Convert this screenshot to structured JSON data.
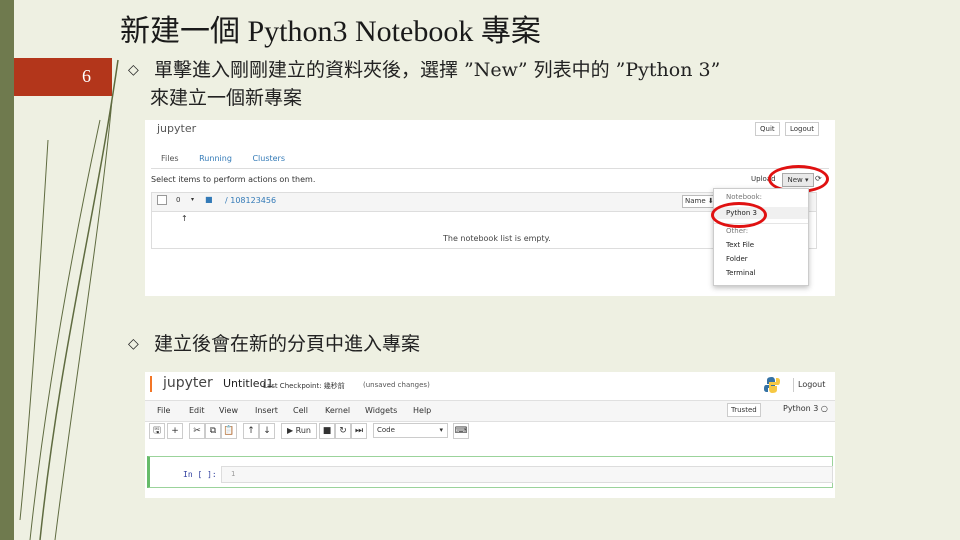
{
  "slide": {
    "number": "6",
    "title": "新建一個 Python3 Notebook 專案",
    "bullets": [
      {
        "line1": "單擊進入剛剛建立的資料夾後，選擇 ”New” 列表中的 ”Python 3”",
        "line2": "來建立一個新專案"
      },
      {
        "line1": "建立後會在新的分頁中進入專案"
      }
    ],
    "colors": {
      "accent": "#b3361b",
      "background": "#eef0e2",
      "sidebar": "#6f7a4e",
      "highlight": "#e01111"
    }
  },
  "shot1": {
    "logo": "jupyter",
    "top_buttons": [
      "Quit",
      "Logout"
    ],
    "tabs": [
      "Files",
      "Running",
      "Clusters"
    ],
    "select_message": "Select items to perform actions on them.",
    "upload_label": "Upload",
    "new_label": "New ▾",
    "refresh_icon": "⟳",
    "select_count": "0",
    "caret": "▾",
    "folder_icon": "■",
    "breadcrumb": "/ 108123456",
    "sort_label": "Name ⬇",
    "up_icon": "↑",
    "empty_message": "The notebook list is empty.",
    "menu": {
      "notebook_header": "Notebook:",
      "python3": "Python 3",
      "other_header": "Other:",
      "items": [
        "Text File",
        "Folder",
        "Terminal"
      ]
    }
  },
  "shot2": {
    "logo": "jupyter",
    "notebook_name": "Untitled1",
    "checkpoint": "Last Checkpoint: 幾秒前",
    "unsaved": "(unsaved changes)",
    "logout": "Logout",
    "menus": [
      "File",
      "Edit",
      "View",
      "Insert",
      "Cell",
      "Kernel",
      "Widgets",
      "Help"
    ],
    "trusted": "Trusted",
    "kernel": "Python 3 ○",
    "toolbar": {
      "save": "🖫",
      "add": "+",
      "cut": "✂",
      "copy": "⧉",
      "paste": "📋",
      "up": "↑",
      "down": "↓",
      "run": "▶ Run",
      "stop": "■",
      "restart": "↻",
      "fast": "⏭",
      "cell_type": "Code",
      "cell_type_caret": "▾",
      "keyboard": "⌨"
    },
    "cell": {
      "prompt": "In [ ]:",
      "line_number": "1"
    }
  }
}
